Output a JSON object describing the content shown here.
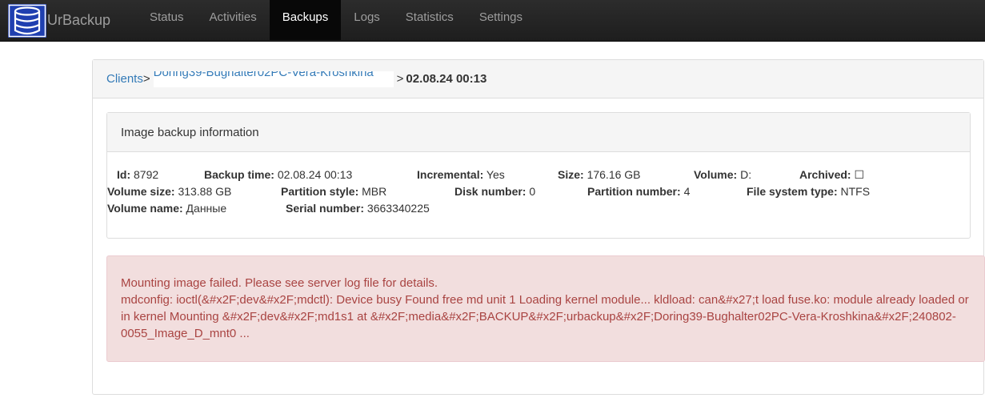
{
  "brand": {
    "name": "UrBackup"
  },
  "nav": {
    "items": [
      "Status",
      "Activities",
      "Backups",
      "Logs",
      "Statistics",
      "Settings"
    ],
    "active": "Backups"
  },
  "breadcrumb": {
    "root": "Clients",
    "separator": ">",
    "client": "Doring39-Bughalter02PC-Vera-Kroshkina",
    "current": "02.08.24 00:13"
  },
  "info": {
    "heading": "Image backup information",
    "id_label": "Id:",
    "id": "8792",
    "backup_time_label": "Backup time:",
    "backup_time": "02.08.24 00:13",
    "incremental_label": "Incremental:",
    "incremental": "Yes",
    "size_label": "Size:",
    "size": "176.16 GB",
    "volume_label": "Volume:",
    "volume": "D:",
    "archived_label": "Archived:",
    "archived": "☐",
    "volume_size_label": "Volume size:",
    "volume_size": "313.88 GB",
    "partition_style_label": "Partition style:",
    "partition_style": "MBR",
    "disk_number_label": "Disk number:",
    "disk_number": "0",
    "partition_number_label": "Partition number:",
    "partition_number": "4",
    "fs_type_label": "File system type:",
    "fs_type": "NTFS",
    "volume_name_label": "Volume name:",
    "volume_name": "Данные",
    "serial_number_label": "Serial number:",
    "serial_number": "3663340225"
  },
  "alert": {
    "line1": "Mounting image failed. Please see server log file for details.",
    "line2": "mdconfig: ioctl(&#x2F;dev&#x2F;mdctl): Device busy Found free md unit 1 Loading kernel module... kldload: can&#x27;t load fuse.ko: module already loaded or in kernel Mounting &#x2F;dev&#x2F;md1s1 at &#x2F;media&#x2F;BACKUP&#x2F;urbackup&#x2F;Doring39-Bughalter02PC-Vera-Kroshkina&#x2F;240802-0055_Image_D_mnt0 ..."
  },
  "colors": {
    "navbar": "#222222",
    "link": "#337ab7",
    "alert_bg": "#f2dede",
    "alert_text": "#a94442"
  }
}
